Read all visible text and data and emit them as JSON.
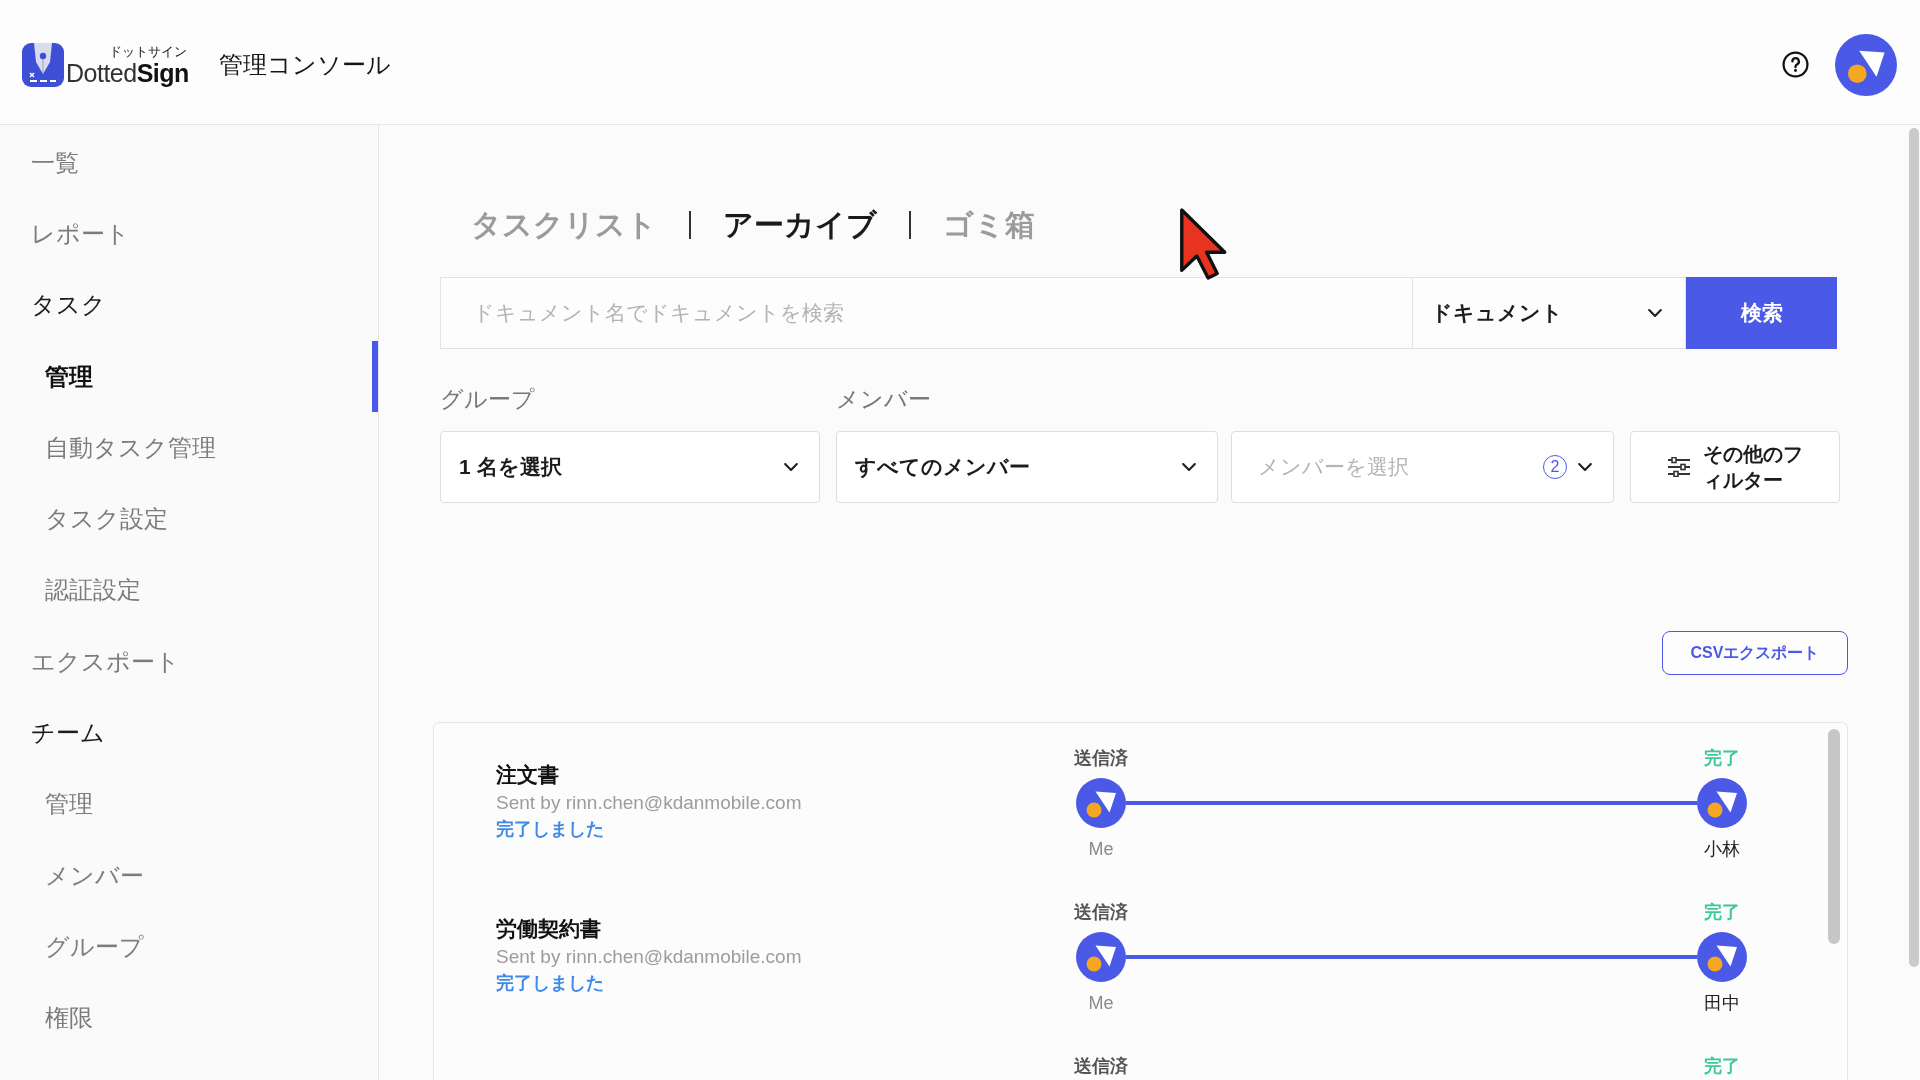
{
  "header": {
    "logo": {
      "kana": "ドットサイン",
      "name": "Dotted**Sign**"
    },
    "title": "管理コンソール"
  },
  "sidebar": {
    "items": [
      {
        "label": "一覧",
        "selected": false
      },
      {
        "label": "レポート",
        "selected": false
      },
      {
        "label": "タスク",
        "selected": false,
        "expanded": true,
        "children": [
          {
            "label": "管理",
            "selected": true
          },
          {
            "label": "自動タスク管理",
            "selected": false
          },
          {
            "label": "タスク設定",
            "selected": false
          },
          {
            "label": "認証設定",
            "selected": false
          }
        ]
      },
      {
        "label": "エクスポート",
        "selected": false
      },
      {
        "label": "チーム",
        "selected": false,
        "expanded": true,
        "children": [
          {
            "label": "管理",
            "selected": false
          },
          {
            "label": "メンバー",
            "selected": false
          },
          {
            "label": "グループ",
            "selected": false
          },
          {
            "label": "権限",
            "selected": false
          }
        ]
      }
    ]
  },
  "tabs": [
    {
      "label": "タスクリスト",
      "selected": false
    },
    {
      "label": "アーカイブ",
      "selected": true
    },
    {
      "label": "ゴミ箱",
      "selected": false
    }
  ],
  "search": {
    "placeholder": "ドキュメント名でドキュメントを検索",
    "scope": "ドキュメント",
    "button": "検索"
  },
  "filters": {
    "group": {
      "label": "グループ",
      "value": "1 名を選択"
    },
    "member": {
      "label": "メンバー",
      "value": "すべてのメンバー",
      "placeholder": "メンバーを選択",
      "count": "2"
    },
    "more": "その他のフィルター"
  },
  "export_button": "CSVエクスポート",
  "documents": [
    {
      "title": "注文書",
      "sender": "Sent by rinn.chen@kdanmobile.com",
      "status": "完了しました",
      "steps": [
        {
          "kind": "sent",
          "label": "送信済",
          "name": "Me"
        },
        {
          "kind": "done",
          "label": "完了",
          "name": "小林"
        }
      ]
    },
    {
      "title": "労働契約書",
      "sender": "Sent by rinn.chen@kdanmobile.com",
      "status": "完了しました",
      "steps": [
        {
          "kind": "sent",
          "label": "送信済",
          "name": "Me"
        },
        {
          "kind": "done",
          "label": "完了",
          "name": "田中"
        }
      ]
    },
    {
      "steps": [
        {
          "kind": "sent",
          "label": "送信済"
        },
        {
          "kind": "done",
          "label": "完了"
        }
      ]
    }
  ]
}
